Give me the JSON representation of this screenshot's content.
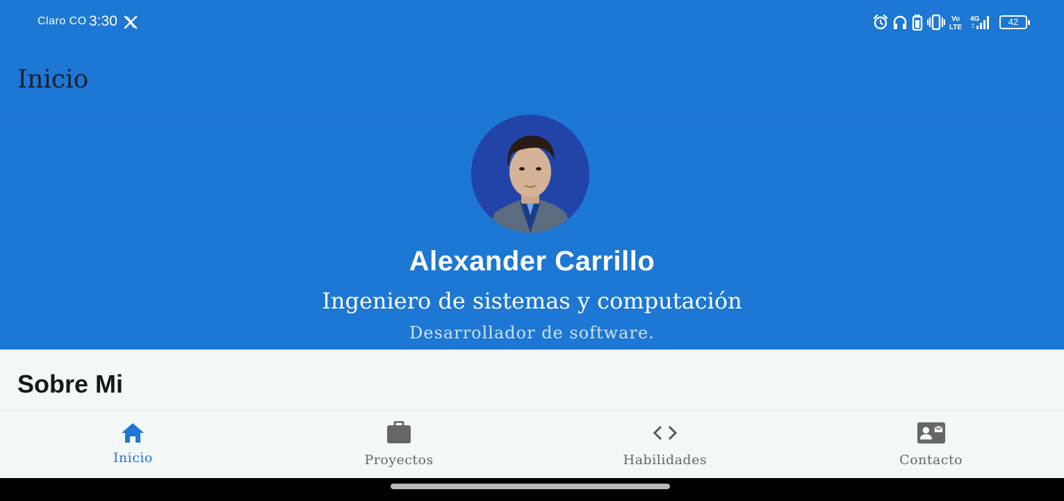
{
  "status_bar": {
    "carrier": "Claro CO",
    "time": "3:30",
    "battery_level": "42",
    "network_label_top": "Vo",
    "network_label_bottom": "LTE",
    "network_type": "4G",
    "icons": [
      "x-logo-icon",
      "alarm-icon",
      "headphones-icon",
      "battery-saver-icon",
      "vibrate-icon",
      "volte-icon",
      "signal-icon",
      "battery-icon"
    ]
  },
  "app_bar": {
    "title": "Inicio"
  },
  "profile": {
    "name": "Alexander Carrillo",
    "role": "Ingeniero de sistemas y computación",
    "subtitle": "Desarrollador de software."
  },
  "about": {
    "title": "Sobre Mi"
  },
  "bottom_nav": {
    "items": [
      {
        "label": "Inicio",
        "icon": "home-icon",
        "active": true
      },
      {
        "label": "Proyectos",
        "icon": "briefcase-icon",
        "active": false
      },
      {
        "label": "Habilidades",
        "icon": "code-icon",
        "active": false
      },
      {
        "label": "Contacto",
        "icon": "contact-card-icon",
        "active": false
      }
    ]
  },
  "colors": {
    "primary": "#1d77d4",
    "avatar_bg": "#2244a8",
    "surface": "#f2f7f8",
    "inactive_nav": "#666666"
  }
}
